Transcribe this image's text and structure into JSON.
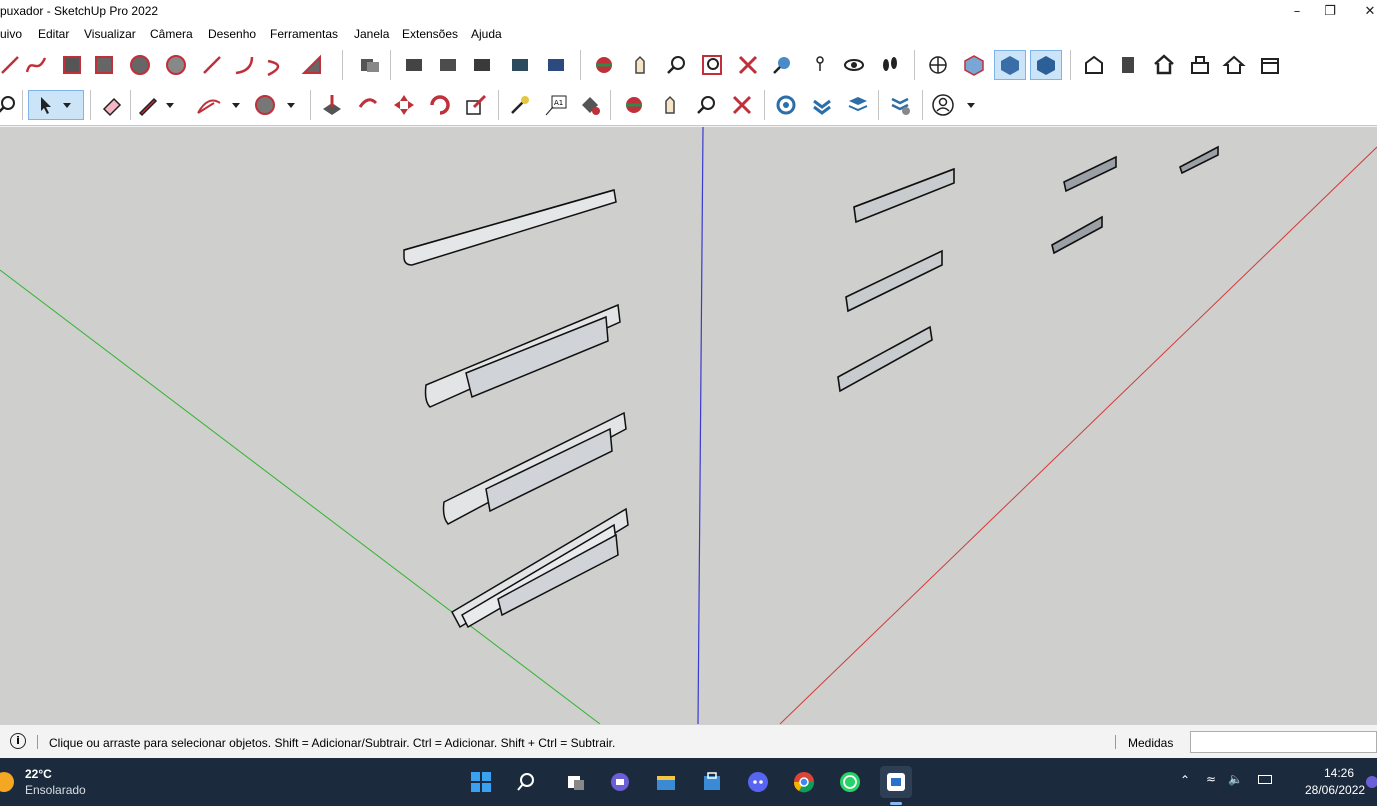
{
  "window": {
    "title": "puxador - SketchUp Pro 2022",
    "minimize_label": "–",
    "restore_label": "❐",
    "close_label": "✕"
  },
  "menu": [
    "uivo",
    "Editar",
    "Visualizar",
    "Câmera",
    "Desenho",
    "Ferramentas",
    "Janela",
    "Extensões",
    "Ajuda"
  ],
  "toolbar_top": {
    "icons": [
      "line-icon",
      "freehand-icon",
      "rectangle-icon",
      "rotated-rectangle-icon",
      "circle-icon",
      "polygon-icon",
      "arc-icon",
      "2-point-arc-icon",
      "3-point-arc-icon",
      "pie-icon",
      "component-icon",
      "paint-icon-1",
      "paint-icon-2",
      "paint-icon-3",
      "paint-icon-4",
      "orbit-icon",
      "pan-icon",
      "zoom-icon",
      "zoom-window-icon",
      "zoom-extents-icon",
      "previous-view-icon",
      "position-camera-icon",
      "look-around-icon",
      "walk-icon",
      "section-plane-icon",
      "iso-view-icon",
      "top-view-icon",
      "front-view-icon",
      "right-view-icon",
      "back-view-icon",
      "left-view-icon",
      "bottom-view-icon",
      "house-icon",
      "house2-icon"
    ]
  },
  "toolbar_bottom": {
    "icons": [
      "search-icon",
      "select-arrow-icon",
      "eraser-icon",
      "pencil-icon",
      "arc-draw-icon",
      "shape-icon",
      "push-pull-icon",
      "follow-me-icon",
      "move-icon",
      "rotate-icon",
      "scale-icon",
      "tape-measure-icon",
      "text-icon",
      "paint-bucket-icon",
      "orbit-icon",
      "pan-icon",
      "zoom-icon",
      "zoom-extents-icon",
      "warehouse-icon",
      "extension-warehouse-icon",
      "layout-icon",
      "extension-manager-icon",
      "profile-icon"
    ]
  },
  "statusbar": {
    "info_icon": "info-icon",
    "message": "Clique ou arraste para selecionar objetos. Shift = Adicionar/Subtrair. Ctrl = Adicionar. Shift + Ctrl = Subtrair.",
    "measures_label": "Medidas",
    "measures_value": ""
  },
  "taskbar": {
    "weather_temp": "22°C",
    "weather_desc": "Ensolarado",
    "time": "14:26",
    "date": "28/06/2022",
    "apps": [
      "windows-start-icon",
      "search-icon",
      "task-view-icon",
      "teams-chat-icon",
      "file-explorer-icon",
      "store-icon",
      "discord-icon",
      "chrome-icon",
      "whatsapp-icon",
      "sketchup-icon"
    ]
  },
  "colors": {
    "viewport_bg": "#cfcfcd",
    "axis_green": "#2fb52f",
    "axis_blue": "#3a3acf",
    "axis_red": "#d23a3a",
    "taskbar_bg": "#1c2a3d"
  }
}
